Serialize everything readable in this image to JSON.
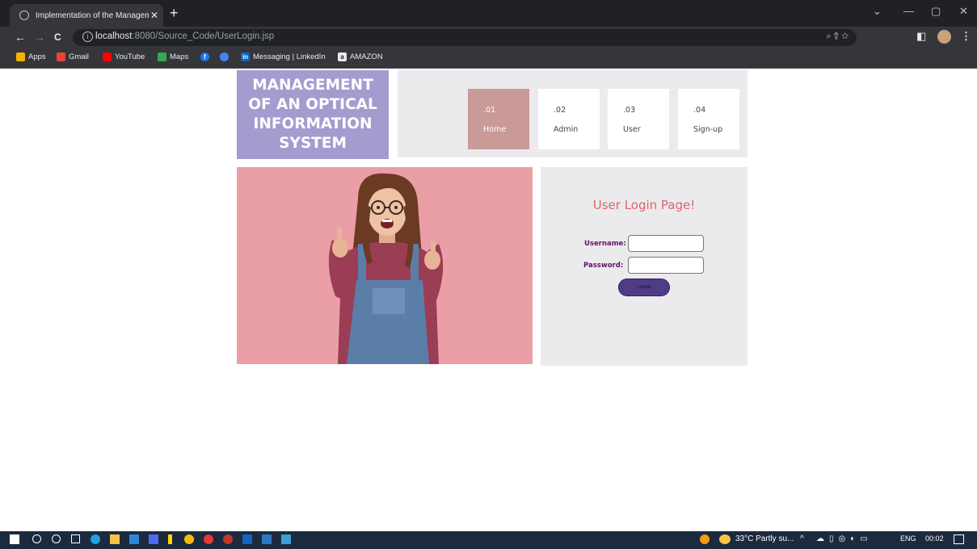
{
  "browser": {
    "tab_title": "Implementation of the Managem",
    "tab_close": "✕",
    "new_tab": "+",
    "window_controls": {
      "minimize": "—",
      "restore": "▢",
      "close": "✕",
      "dropdown": "⌄"
    },
    "nav": {
      "back": "←",
      "forward": "→",
      "reload": "C"
    },
    "url_host": "localhost",
    "url_rest": ":8080/Source_Code/UserLogin.jsp",
    "omnibox_icons": "⌕   ⇪   ☆",
    "toolbar_icons": {
      "sidepanel": "◧",
      "menu": "⋮"
    },
    "bookmarks": [
      {
        "label": "Apps",
        "icon": "apps-grid-icon",
        "color": "#f4b400"
      },
      {
        "label": "Gmail",
        "icon": "gmail-icon",
        "color": "#ea4335"
      },
      {
        "label": "YouTube",
        "icon": "youtube-icon",
        "color": "#ff0000"
      },
      {
        "label": "Maps",
        "icon": "maps-icon",
        "color": "#34a853"
      },
      {
        "label": "",
        "icon": "facebook-icon",
        "color": "#1877f2"
      },
      {
        "label": "",
        "icon": "chrome-app-icon",
        "color": "#4285f4"
      },
      {
        "label": "Messaging | LinkedIn",
        "icon": "linkedin-icon",
        "color": "#0a66c2"
      },
      {
        "label": "AMAZON",
        "icon": "amazon-icon",
        "color": "#e8eaed"
      }
    ],
    "bookmark_glyphs": {
      "linkedin": "in",
      "amazon": "a",
      "facebook": "f"
    }
  },
  "page": {
    "logo_text": "MANAGEMENT OF AN OPTICAL INFORMATION SYSTEM",
    "nav_items": [
      {
        "num": ".01",
        "label": "Home",
        "active": true
      },
      {
        "num": ".02",
        "label": "Admin",
        "active": false
      },
      {
        "num": ".03",
        "label": "User",
        "active": false
      },
      {
        "num": ".04",
        "label": "Sign-up",
        "active": false
      }
    ],
    "login": {
      "title": "User Login Page!",
      "username_label": "Username:",
      "username_value": "",
      "password_label": "Password:",
      "password_value": "",
      "button_label": "LOGIN"
    },
    "colors": {
      "logo_bg": "#a49ccf",
      "hero_bg": "#ea9ea5",
      "active_nav": "#c99a98",
      "title": "#e0636c",
      "label": "#6a0f6a",
      "button": "#4e3c87"
    }
  },
  "taskbar": {
    "weather": "33°C  Partly su...",
    "tray_icons": "^",
    "language": "ENG",
    "time": "00:02"
  }
}
